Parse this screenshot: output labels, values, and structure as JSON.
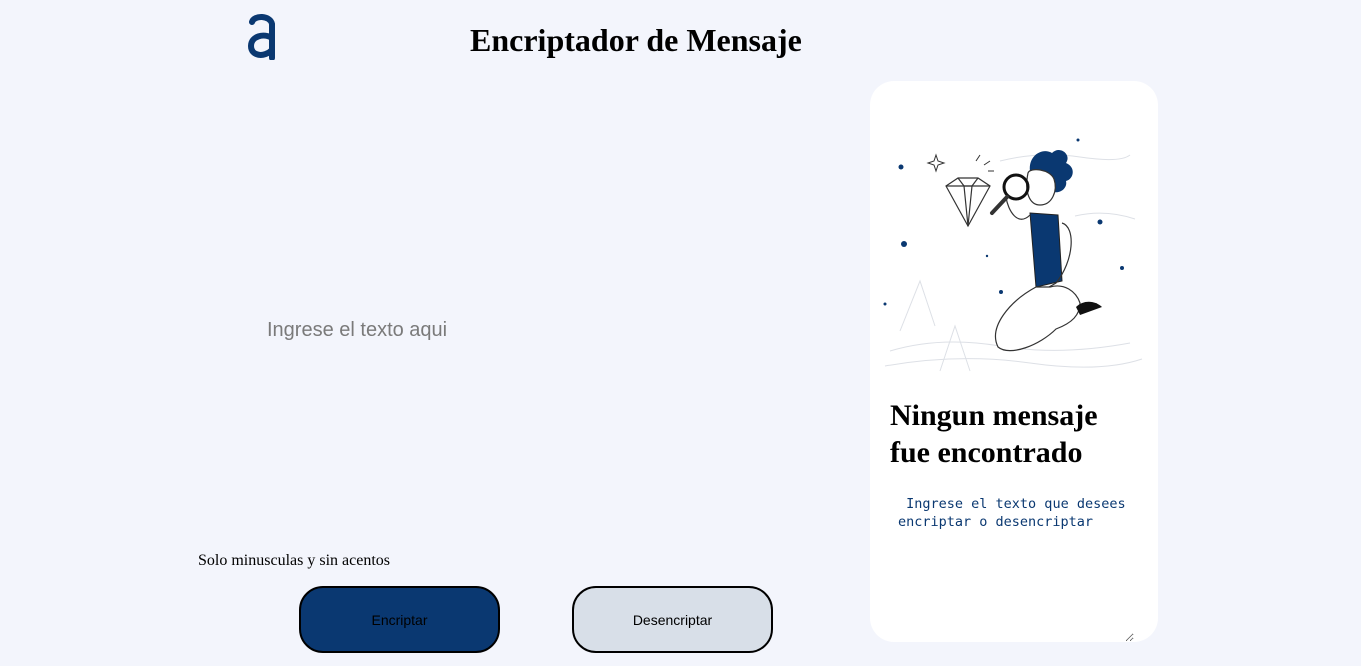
{
  "header": {
    "title": "Encriptador de Mensaje",
    "logo_icon": "alura-a-logo-icon"
  },
  "input": {
    "placeholder": "Ingrese el texto aqui",
    "value": ""
  },
  "hint": {
    "text": "Solo minusculas y sin acentos"
  },
  "buttons": {
    "encrypt_label": "Encriptar",
    "decrypt_label": "Desencriptar"
  },
  "result_panel": {
    "heading": "Ningun mensaje fue encontrado",
    "placeholder": " Ingrese el texto que desees encriptar o desencriptar",
    "illustration_icon": "person-magnifier-diamond-illustration"
  },
  "colors": {
    "background": "#f3f5fc",
    "primary": "#0a3871",
    "secondary_button": "#d8dfe8",
    "panel": "#ffffff"
  }
}
